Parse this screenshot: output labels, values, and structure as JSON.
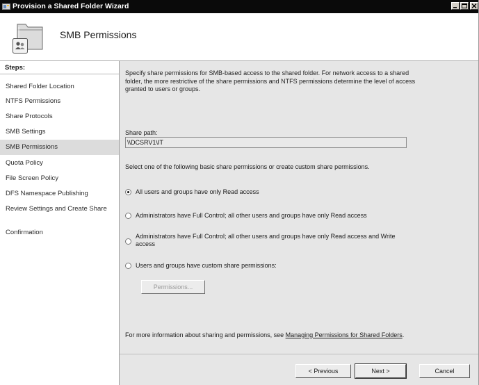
{
  "window": {
    "title": "Provision a Shared Folder Wizard"
  },
  "header": {
    "page_title": "SMB Permissions",
    "icon": "shared-folder-users-icon"
  },
  "sidebar": {
    "steps_label": "Steps:",
    "items": [
      {
        "label": "Shared Folder Location"
      },
      {
        "label": "NTFS Permissions"
      },
      {
        "label": "Share Protocols"
      },
      {
        "label": "SMB Settings"
      },
      {
        "label": "SMB Permissions",
        "active": true
      },
      {
        "label": "Quota Policy"
      },
      {
        "label": "File Screen Policy"
      },
      {
        "label": "DFS Namespace Publishing"
      },
      {
        "label": "Review Settings and Create Share"
      },
      {
        "label": "Confirmation"
      }
    ]
  },
  "main": {
    "intro": "Specify share permissions for SMB-based access to the shared folder. For network access to a shared folder, the more restrictive of the share permissions and NTFS permissions determine the level of access granted to users or groups.",
    "share_path_label": "Share path:",
    "share_path_value": "\\\\DCSRV1\\IT",
    "select_text": "Select one of the following basic share permissions or create custom share permissions.",
    "options": [
      {
        "label": "All users and groups have only Read access",
        "selected": true
      },
      {
        "label": "Administrators have Full Control; all other users and groups have only Read access",
        "selected": false
      },
      {
        "label": "Administrators have Full Control; all other users and groups have only Read access and Write access",
        "selected": false
      },
      {
        "label": "Users and groups have custom share permissions:",
        "selected": false
      }
    ],
    "permissions_button": "Permissions...",
    "more_info_prefix": "For more information about sharing and permissions, see ",
    "more_info_link": "Managing Permissions for Shared Folders",
    "more_info_suffix": "."
  },
  "footer": {
    "previous": "< Previous",
    "next": "Next >",
    "cancel": "Cancel"
  }
}
